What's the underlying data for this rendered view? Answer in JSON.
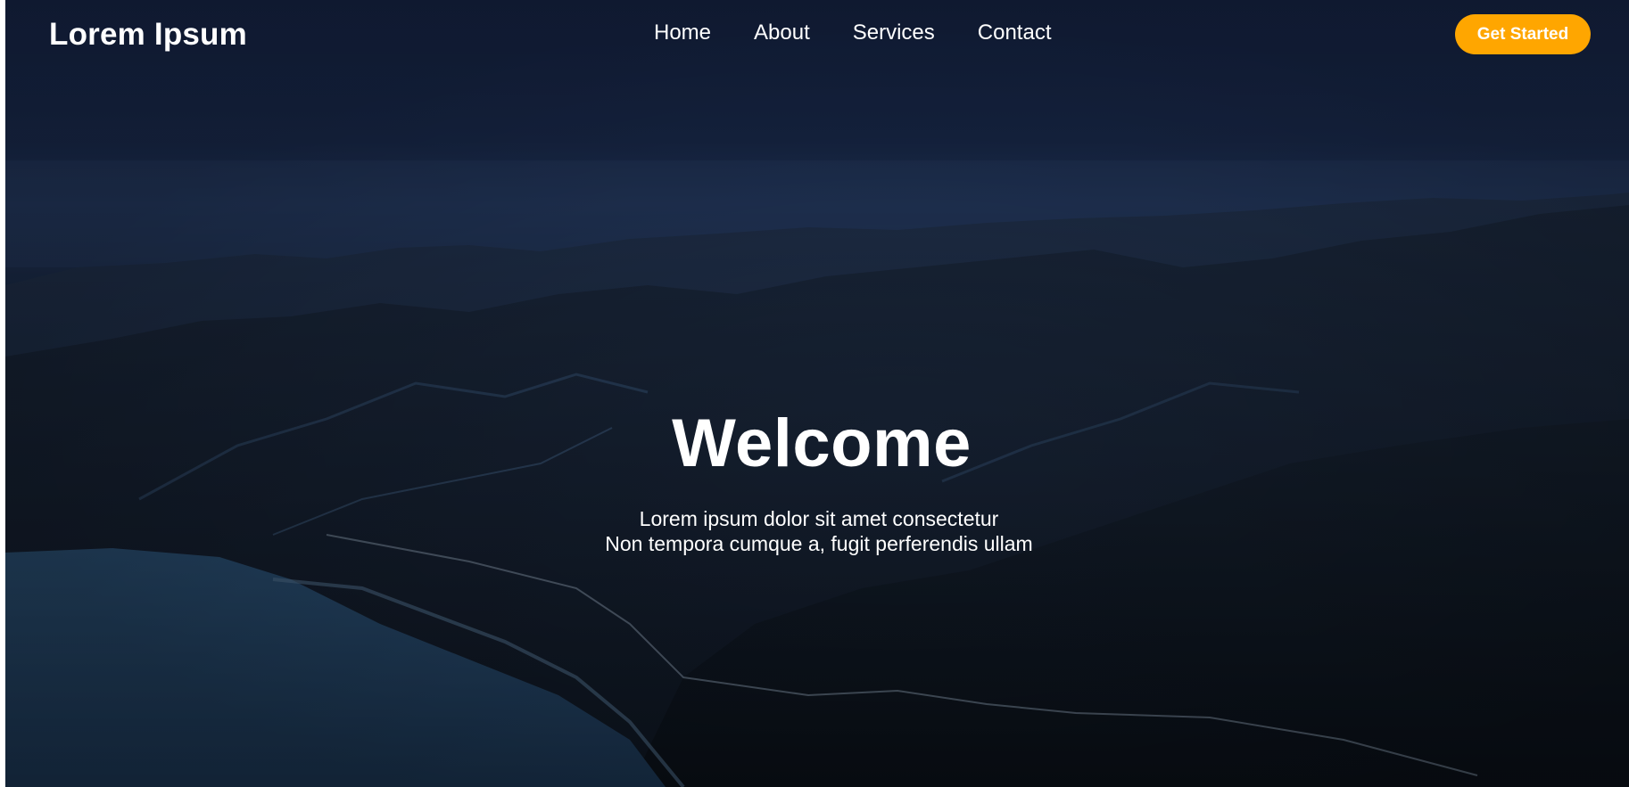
{
  "brand": {
    "name": "Lorem Ipsum"
  },
  "nav": {
    "items": [
      {
        "label": "Home"
      },
      {
        "label": "About"
      },
      {
        "label": "Services"
      },
      {
        "label": "Contact"
      }
    ],
    "cta_label": "Get Started"
  },
  "hero": {
    "title": "Welcome",
    "subtitle_line1": "Lorem ipsum dolor sit amet consectetur",
    "subtitle_line2": "Non tempora cumque a, fugit perferendis ullam"
  },
  "colors": {
    "accent": "#ffa600",
    "text": "#ffffff",
    "sky": "#17264a"
  }
}
